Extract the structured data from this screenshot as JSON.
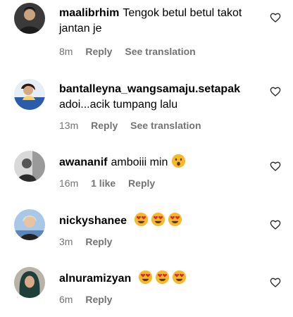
{
  "comments": [
    {
      "username": "maalibrhim",
      "text": "Tengok betul betul takot jantan je",
      "time": "8m",
      "reply": "Reply",
      "translate": "See translation"
    },
    {
      "username": "bantalleyna_wangsamaju.setapak",
      "text": "adoi...acik tumpang lalu",
      "time": "13m",
      "reply": "Reply",
      "translate": "See translation"
    },
    {
      "username": "awananif",
      "text": "amboiii min",
      "time": "16m",
      "likes": "1 like",
      "reply": "Reply"
    },
    {
      "username": "nickyshanee",
      "text": "",
      "time": "3m",
      "reply": "Reply"
    },
    {
      "username": "alnuramizyan",
      "text": "",
      "time": "6m",
      "reply": "Reply"
    }
  ],
  "icons": {
    "heart": "heart-outline-icon",
    "emoji_wow": "hushed-face-emoji",
    "emoji_love": "heart-eyes-emoji"
  },
  "colors": {
    "meta_text": "#737373",
    "emoji_yellow": "#f7b92a",
    "emoji_red": "#e0243b"
  }
}
